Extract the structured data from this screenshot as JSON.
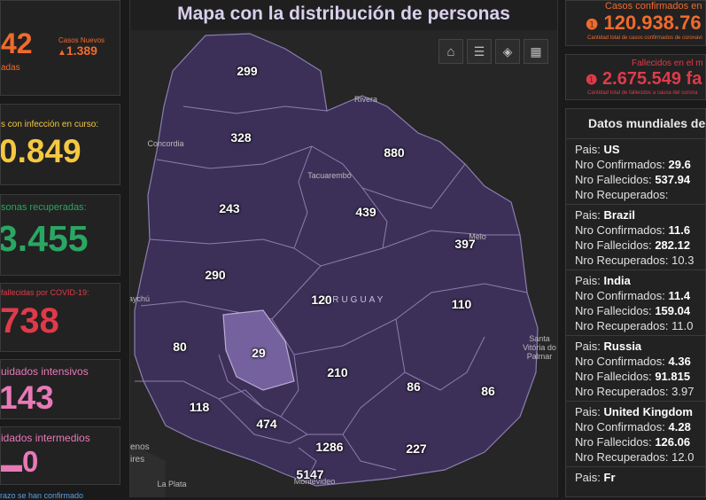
{
  "left": {
    "top": {
      "partial_value": "42",
      "partial_caption": "adas",
      "new_label": "Casos Nuevos",
      "new_value": "1.389"
    },
    "active": {
      "label": "s con infección en curso:",
      "value": "0.849"
    },
    "recovered": {
      "label": "sonas recuperadas:",
      "value": "3.455"
    },
    "deceased": {
      "label": "fallecidas por COVID-19:",
      "value": "738"
    },
    "intensive": {
      "label": "uidados intensivos",
      "value": "143"
    },
    "intermediate": {
      "label": "idados intermedios",
      "value": "0"
    },
    "footer_text": "razo se han confirmado"
  },
  "map": {
    "title": "Mapa con la distribución de personas",
    "tools": [
      "home-icon",
      "legend-list-icon",
      "layers-icon",
      "qr-grid-icon"
    ],
    "country_label": "URUGUAY",
    "places": [
      "Rivera",
      "Concordia",
      "Tacuarembó",
      "Melo",
      "Santa Vitória do Palmar",
      "aychú",
      "enos ires",
      "La Plata",
      "Montevideo"
    ],
    "department_counts": [
      "299",
      "328",
      "880",
      "243",
      "439",
      "397",
      "290",
      "120",
      "110",
      "80",
      "29",
      "210",
      "86",
      "86",
      "118",
      "474",
      "1286",
      "227",
      "5147"
    ]
  },
  "right": {
    "confirmed": {
      "label": "Casos confirmados en",
      "value": "120.938.76",
      "caption": "Cantidad total de casos confirmados de coronavi"
    },
    "deaths": {
      "label": "Fallecidos en el m",
      "value": "2.675.549 fa",
      "caption": "Cantidad total de fallecidos a causa del corona"
    },
    "world_title": "Datos mundiales del",
    "country_key": "Pais:",
    "confirmed_key": "Nro Confirmados:",
    "deaths_key": "Nro Fallecidos:",
    "recovered_key": "Nro Recuperados:",
    "countries": [
      {
        "name": "US",
        "confirmed": "29.6",
        "deaths": "537.94",
        "recovered": ""
      },
      {
        "name": "Brazil",
        "confirmed": "11.6",
        "deaths": "282.12",
        "recovered": "10.3"
      },
      {
        "name": "India",
        "confirmed": "11.4",
        "deaths": "159.04",
        "recovered": "11.0"
      },
      {
        "name": "Russia",
        "confirmed": "4.36",
        "deaths": "91.815",
        "recovered": "3.97"
      },
      {
        "name": "United Kingdom",
        "confirmed": "4.28",
        "deaths": "126.06",
        "recovered": "12.0"
      },
      {
        "name": "Fr",
        "confirmed": "",
        "deaths": "",
        "recovered": ""
      }
    ]
  },
  "colors": {
    "orange": "#f06b2d",
    "yellow": "#f5c842",
    "green": "#2aa663",
    "red": "#e03a4a",
    "pink": "#e879b8",
    "map_fill": "#3d3058",
    "map_highlight": "#75619e"
  }
}
